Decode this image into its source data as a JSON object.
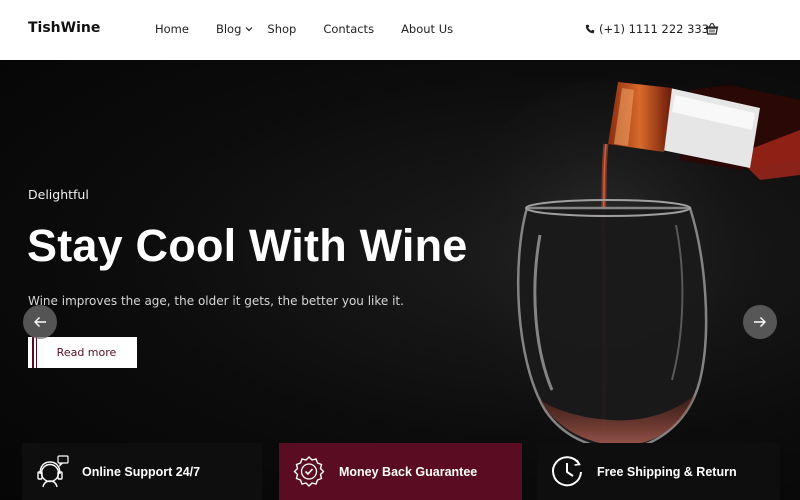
{
  "header": {
    "logo": "TishWine",
    "nav": [
      {
        "label": "Home"
      },
      {
        "label": "Blog"
      },
      {
        "label": "Shop"
      },
      {
        "label": "Contacts"
      },
      {
        "label": "About Us"
      }
    ],
    "phone": "(+1) 1111 222 333",
    "phone_icon": "phone-icon",
    "cart_icon": "shopping-basket-icon"
  },
  "hero": {
    "eyebrow": "Delightful",
    "headline": "Stay Cool With Wine",
    "tagline": "Wine improves the age, the older it gets, the better you like it.",
    "cta_label": "Read more",
    "prev_icon": "arrow-left-icon",
    "next_icon": "arrow-right-icon"
  },
  "features": [
    {
      "label": "Online Support 24/7",
      "icon": "support-headset-icon"
    },
    {
      "label": "Money Back Guarantee",
      "icon": "badge-check-icon"
    },
    {
      "label": "Free Shipping & Return",
      "icon": "clock-icon"
    }
  ],
  "colors": {
    "accent": "#5a0d22",
    "header_bg": "#ffffff",
    "hero_bg": "#0a0a0a"
  }
}
